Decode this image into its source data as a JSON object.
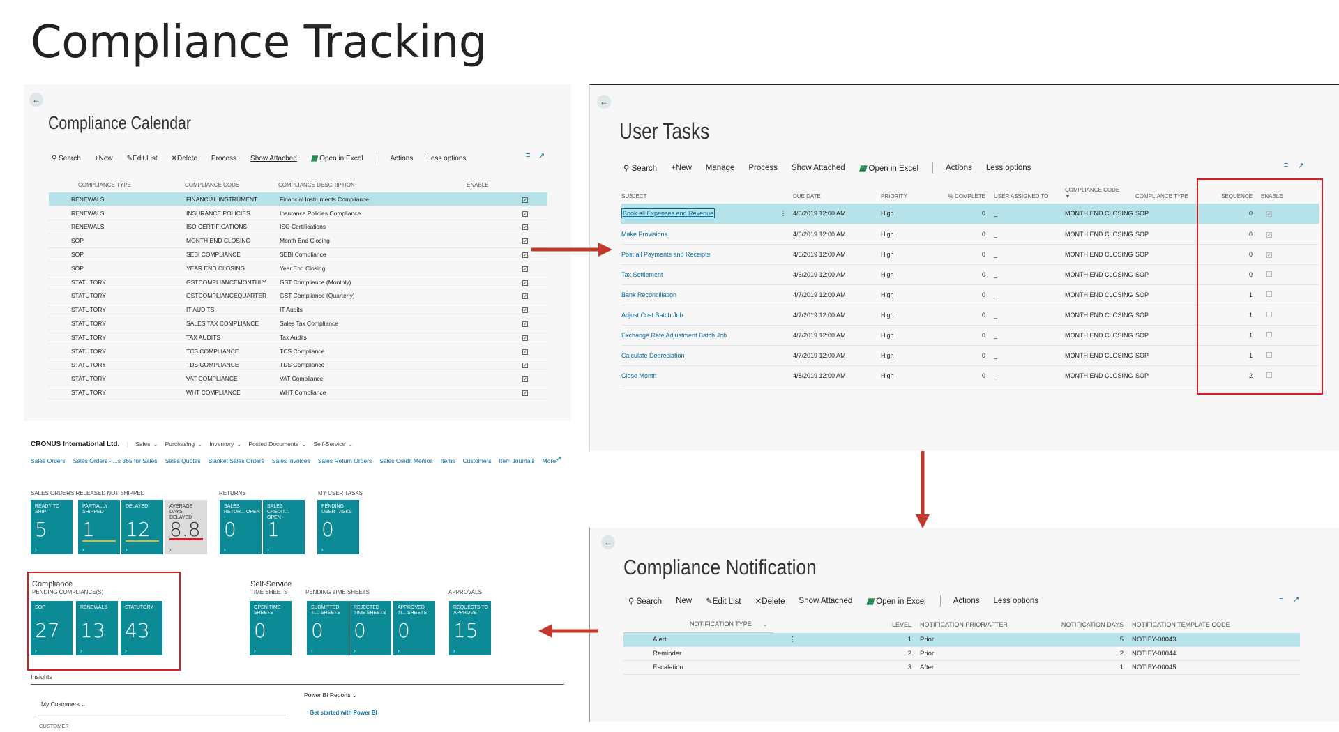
{
  "slide_title": "Compliance Tracking",
  "calendar": {
    "title": "Compliance Calendar",
    "toolbar": [
      "Search",
      "New",
      "Edit List",
      "Delete",
      "Process",
      "Show Attached",
      "Open in Excel",
      "Actions",
      "Less options"
    ],
    "headers": [
      "COMPLIANCE TYPE",
      "COMPLIANCE CODE",
      "COMPLIANCE DESCRIPTION",
      "ENABLE"
    ],
    "rows": [
      [
        "RENEWALS",
        "FINANCIAL INSTRUMENT",
        "Financial Instruments Compliance"
      ],
      [
        "RENEWALS",
        "INSURANCE POLICIES",
        "Insurance Policies Compliance"
      ],
      [
        "RENEWALS",
        "ISO CERTIFICATIONS",
        "ISO Certifications"
      ],
      [
        "SOP",
        "MONTH END CLOSING",
        "Month End Closing"
      ],
      [
        "SOP",
        "SEBI COMPLIANCE",
        "SEBI Compliance"
      ],
      [
        "SOP",
        "YEAR END CLOSING",
        "Year End Closing"
      ],
      [
        "STATUTORY",
        "GSTCOMPLIANCEMONTHLY",
        "GST Compliance (Monthly)"
      ],
      [
        "STATUTORY",
        "GSTCOMPLIANCEQUARTER",
        "GST Compliance (Quarterly)"
      ],
      [
        "STATUTORY",
        "IT AUDITS",
        "IT Audits"
      ],
      [
        "STATUTORY",
        "SALES TAX COMPLIANCE",
        "Sales Tax Compliance"
      ],
      [
        "STATUTORY",
        "TAX AUDITS",
        "Tax Audits"
      ],
      [
        "STATUTORY",
        "TCS COMPLIANCE",
        "TCS Compliance"
      ],
      [
        "STATUTORY",
        "TDS COMPLIANCE",
        "TDS Compliance"
      ],
      [
        "STATUTORY",
        "VAT COMPLIANCE",
        "VAT Compliance"
      ],
      [
        "STATUTORY",
        "WHT COMPLIANCE",
        "WHT Compliance"
      ]
    ]
  },
  "tasks": {
    "title": "User Tasks",
    "toolbar": [
      "Search",
      "New",
      "Manage",
      "Process",
      "Show Attached",
      "Open in Excel",
      "Actions",
      "Less options"
    ],
    "headers": [
      "SUBJECT",
      "DUE DATE",
      "PRIORITY",
      "% COMPLETE",
      "USER ASSIGNED TO",
      "COMPLIANCE CODE",
      "COMPLIANCE TYPE",
      "SEQUENCE",
      "ENABLE"
    ],
    "rows": [
      [
        "Book all Expenses and Revenue",
        "4/6/2019 12:00 AM",
        "High",
        "0",
        "_",
        "MONTH END CLOSING",
        "SOP",
        "0",
        "✓"
      ],
      [
        "Make Provisions",
        "4/6/2019 12:00 AM",
        "High",
        "0",
        "_",
        "MONTH END CLOSING",
        "SOP",
        "0",
        "✓"
      ],
      [
        "Post all Payments and Receipts",
        "4/6/2019 12:00 AM",
        "High",
        "0",
        "_",
        "MONTH END CLOSING",
        "SOP",
        "0",
        "✓"
      ],
      [
        "Tax Settlement",
        "4/6/2019 12:00 AM",
        "High",
        "0",
        "_",
        "MONTH END CLOSING",
        "SOP",
        "0",
        ""
      ],
      [
        "Bank Reconciliation",
        "4/7/2019 12:00 AM",
        "High",
        "0",
        "_",
        "MONTH END CLOSING",
        "SOP",
        "1",
        ""
      ],
      [
        "Adjust Cost Batch Job",
        "4/7/2019 12:00 AM",
        "High",
        "0",
        "_",
        "MONTH END CLOSING",
        "SOP",
        "1",
        ""
      ],
      [
        "Exchange Rate Adjustment Batch Job",
        "4/7/2019 12:00 AM",
        "High",
        "0",
        "_",
        "MONTH END CLOSING",
        "SOP",
        "1",
        ""
      ],
      [
        "Calculate Depreciation",
        "4/7/2019 12:00 AM",
        "High",
        "0",
        "_",
        "MONTH END CLOSING",
        "SOP",
        "1",
        ""
      ],
      [
        "Close Month",
        "4/8/2019 12:00 AM",
        "High",
        "0",
        "_",
        "MONTH END CLOSING",
        "SOP",
        "2",
        ""
      ]
    ]
  },
  "notification": {
    "title": "Compliance Notification",
    "toolbar": [
      "Search",
      "New",
      "Edit List",
      "Delete",
      "Show Attached",
      "Open in Excel",
      "Actions",
      "Less options"
    ],
    "headers": [
      "NOTIFICATION TYPE",
      "LEVEL",
      "NOTIFICATION PRIOR/AFTER",
      "NOTIFICATION DAYS",
      "NOTIFICATION TEMPLATE CODE"
    ],
    "rows": [
      [
        "Alert",
        "1",
        "Prior",
        "5",
        "NOTIFY-00043"
      ],
      [
        "Reminder",
        "2",
        "Prior",
        "2",
        "NOTIFY-00044"
      ],
      [
        "Escalation",
        "3",
        "After",
        "1",
        "NOTIFY-00045"
      ]
    ]
  },
  "rolecenter": {
    "company": "CRONUS International Ltd.",
    "menu": [
      "Sales",
      "Purchasing",
      "Inventory",
      "Posted Documents",
      "Self-Service"
    ],
    "links": [
      "Sales Orders",
      "Sales Orders - ...s 365 for Sales",
      "Sales Quotes",
      "Blanket Sales Orders",
      "Sales Invoices",
      "Sales Return Orders",
      "Sales Credit Memos",
      "Items",
      "Customers",
      "Item Journals",
      "More"
    ],
    "sec1": "SALES ORDERS RELEASED NOT SHIPPED",
    "sec2": "RETURNS",
    "sec3": "MY USER TASKS",
    "tiles1": [
      {
        "label": "READY TO SHIP",
        "value": "5"
      },
      {
        "label": "PARTIALLY SHIPPED",
        "value": "1"
      },
      {
        "label": "DELAYED",
        "value": "12"
      },
      {
        "label": "AVERAGE DAYS DELAYED",
        "value": "8.8"
      },
      {
        "label": "SALES RETUR... OPEN -",
        "value": "0"
      },
      {
        "label": "SALES CREDIT... OPEN -",
        "value": "1"
      },
      {
        "label": "PENDING USER TASKS",
        "value": "0"
      }
    ],
    "compliance_title": "Compliance",
    "compliance_sub": "PENDING COMPLIANCE(S)",
    "compliance_tiles": [
      {
        "label": "SOP",
        "value": "27"
      },
      {
        "label": "RENEWALS",
        "value": "13"
      },
      {
        "label": "STATUTORY",
        "value": "43"
      }
    ],
    "selfservice_title": "Self-Service",
    "ts_sub": "TIME SHEETS",
    "pts_sub": "PENDING TIME SHEETS",
    "appr_sub": "APPROVALS",
    "ss_tiles": [
      {
        "label": "OPEN TIME SHEETS",
        "value": "0"
      },
      {
        "label": "SUBMITTED TI... SHEETS",
        "value": "0"
      },
      {
        "label": "REJECTED TIME SHEETS",
        "value": "0"
      },
      {
        "label": "APPROVED TI... SHEETS",
        "value": "0"
      },
      {
        "label": "REQUESTS TO APPROVE",
        "value": "15"
      }
    ],
    "insights": "Insights",
    "my_customers": "My Customers",
    "customer_col": "CUSTOMER",
    "powerbi": "Power BI Reports",
    "powerbi_link": "Get started with Power BI"
  },
  "colors": {
    "teal": "#0c8a96",
    "highlight": "#b6e3ea",
    "red": "#d21f26",
    "link": "#0a6b9a"
  }
}
